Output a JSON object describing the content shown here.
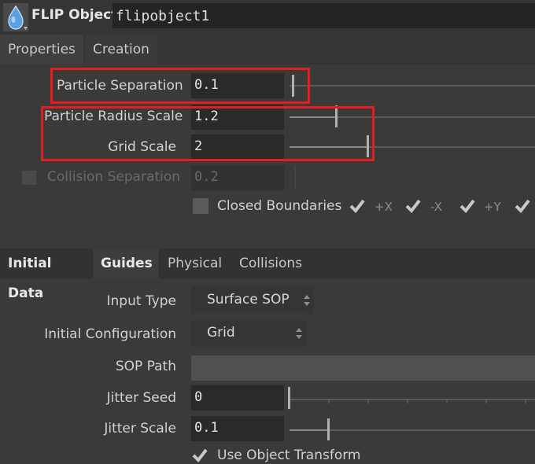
{
  "header": {
    "object_type": "FLIP Object",
    "object_name": "flipobject1",
    "icon": "flip-object-icon"
  },
  "tabs_top": [
    {
      "label": "Properties",
      "active": true
    },
    {
      "label": "Creation",
      "active": false
    }
  ],
  "properties": {
    "particle_separation": {
      "label": "Particle Separation",
      "value": "0.1"
    },
    "particle_radius_scale": {
      "label": "Particle Radius Scale",
      "value": "1.2"
    },
    "grid_scale": {
      "label": "Grid Scale",
      "value": "2"
    },
    "collision_separation": {
      "label": "Collision Separation",
      "value": "0.2",
      "enabled": false
    },
    "closed_boundaries": {
      "label": "Closed Boundaries",
      "axes": [
        "+X",
        "-X",
        "+Y"
      ]
    }
  },
  "tabs_bottom": [
    {
      "label": "Initial Data",
      "active": false
    },
    {
      "label": "Guides",
      "active": true
    },
    {
      "label": "Physical",
      "active": false
    },
    {
      "label": "Collisions",
      "active": false
    }
  ],
  "initial_data": {
    "input_type": {
      "label": "Input Type",
      "value": "Surface SOP"
    },
    "initial_configuration": {
      "label": "Initial Configuration",
      "value": "Grid"
    },
    "sop_path": {
      "label": "SOP Path",
      "value": ""
    },
    "jitter_seed": {
      "label": "Jitter Seed",
      "value": "0"
    },
    "jitter_scale": {
      "label": "Jitter Scale",
      "value": "0.1"
    },
    "use_object_transform": {
      "label": "Use Object Transform"
    }
  },
  "colors": {
    "highlight": "#e02020",
    "background": "#3a3a3a",
    "field": "#2a2a2a"
  }
}
